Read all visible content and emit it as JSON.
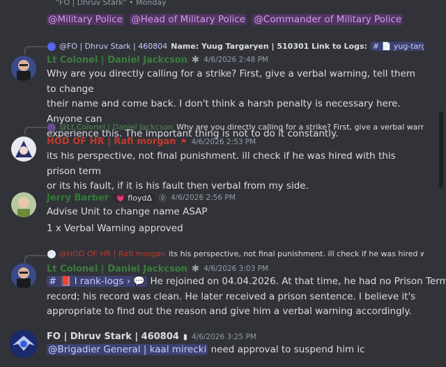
{
  "top": {
    "quoted_header": "\"FO | Dhruv Stark\" • Monday",
    "role_mentions": [
      "@Military Police",
      "@Head of Military Police",
      "@Commander of Military Police"
    ]
  },
  "messages": [
    {
      "reply": {
        "author": "@FO | Dhruv Stark | 460804",
        "preview_prefix": "Name: Yuug Targaryen | 510301 Link to Logs:",
        "channel_chip": "# 📄 yug-targarye..."
      },
      "author": "Lt Colonel | Daniel Jackcson",
      "author_color": "#3a7d3a",
      "timestamp": "4/6/2026 2:48 PM",
      "lines": [
        "Why are you directly calling for a strike? First, give a verbal warning, tell them to change",
        "their name and come back. I don't think a harsh penalty is necessary here. Anyone can",
        "experience this. The important thing is not to do it constantly."
      ]
    },
    {
      "reply": {
        "author": "@Lt Colonel | Daniel Jackcson",
        "preview": "Why are you directly calling for a strike? First, give a verbal warni..."
      },
      "author": "HOD OF HR | Rafi morgan",
      "author_color": "#c0392b",
      "timestamp": "4/6/2026 2:53 PM",
      "lines": [
        "its his perspective, not final punishment. ill check if he was hired with this prison term",
        "or its his fault, if it is his fault then verbal from my side."
      ]
    },
    {
      "author": "Jerry Barber",
      "author_color": "#2f7d32",
      "badge": "💗 floydΔ",
      "timestamp": "4/6/2026 2:56 PM",
      "lines": [
        "Advise Unit to change name ASAP",
        "1 x Verbal Warning approved"
      ]
    },
    {
      "reply": {
        "author": "@HOD OF HR | Rafi morgan",
        "preview": "its his perspective, not final punishment. ill check if he was hired wi..."
      },
      "author": "Lt Colonel | Daniel Jackcson",
      "author_color": "#3a7d3a",
      "timestamp": "4/6/2026 3:03 PM",
      "channel_chip": "# 📕 l rank-logs › 💬",
      "lines_first": "He rejoined on 04.04.2026. At that time, he had no Prison Term",
      "lines": [
        "record; his record was clean. He later received a prison sentence. I believe it's",
        "appropriate to find out the reason and give him a verbal warning accordingly."
      ]
    },
    {
      "author": "FO | Dhruv Stark | 460804",
      "author_color": "#dbdee1",
      "timestamp": "4/6/2026 3:25 PM",
      "mention": "@Brigadier General | kaal mirecki",
      "line_rest": "need approval to suspend him ic"
    }
  ],
  "colors": {
    "background": "#323339",
    "text": "#dbdee1",
    "muted": "#949ba4",
    "role_mention": "#d69af0",
    "user_mention": "#c9cdfb"
  },
  "icons": [
    "avatar-bald-man-icon",
    "avatar-anime-icon",
    "avatar-child-icon",
    "avatar-winged-emblem-icon",
    "snowflake-icon",
    "heart-icon",
    "phone-icon",
    "flag-icon"
  ]
}
